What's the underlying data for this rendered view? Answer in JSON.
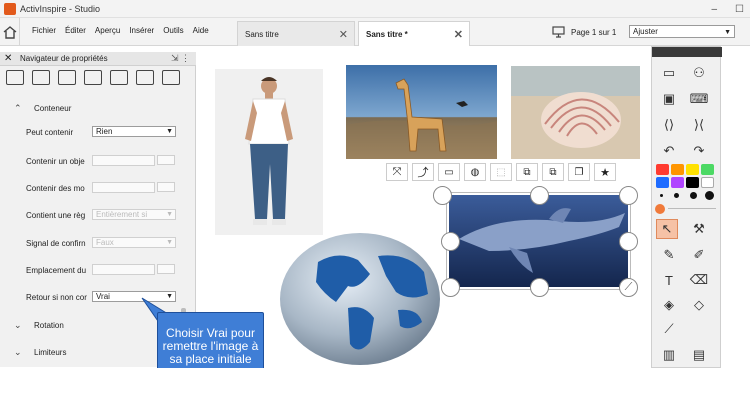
{
  "window": {
    "title": "ActivInspire - Studio",
    "minimize": "–",
    "maximize": "☐"
  },
  "menu": [
    "Fichier",
    "Éditer",
    "Aperçu",
    "Insérer",
    "Outils",
    "Aide"
  ],
  "tabs": [
    {
      "label": "Sans titre",
      "active": false
    },
    {
      "label": "Sans titre *",
      "active": true
    }
  ],
  "page_indicator": "Page 1 sur 1",
  "zoom": {
    "value": "Ajuster"
  },
  "property_navigator": {
    "title": "Navigateur de propriétés",
    "sections": {
      "conteneur": "Conteneur",
      "rotation": "Rotation",
      "limiteurs": "Limiteurs"
    },
    "rows": [
      {
        "label": "Peut contenir",
        "value": "Rien"
      },
      {
        "label": "Contenir un obje",
        "value": ""
      },
      {
        "label": "Contenir des mo",
        "value": ""
      },
      {
        "label": "Contient une règ",
        "value": "Entièrement si"
      },
      {
        "label": "Signal de confirn",
        "value": "Faux"
      },
      {
        "label": "Emplacement du",
        "value": ""
      },
      {
        "label": "Retour si non cor",
        "value": "Vrai"
      }
    ]
  },
  "callout": {
    "text": "Choisir Vrai pour remettre l'image à sa place initiale"
  },
  "colors": {
    "accent": "#3f7ed6",
    "swatches": [
      "#ff3b30",
      "#ff9500",
      "#ffe100",
      "#4cd964",
      "#1e6bff",
      "#b044ff",
      "#000000",
      "#ffffff"
    ],
    "selected_color": "#f07a3a"
  },
  "icons": [
    "home-icon",
    "property-navigator-icon",
    "select-tool-icon",
    "pen-icon",
    "highlighter-icon",
    "text-icon",
    "eraser-icon",
    "fill-icon",
    "shapes-icon",
    "connector-icon"
  ]
}
